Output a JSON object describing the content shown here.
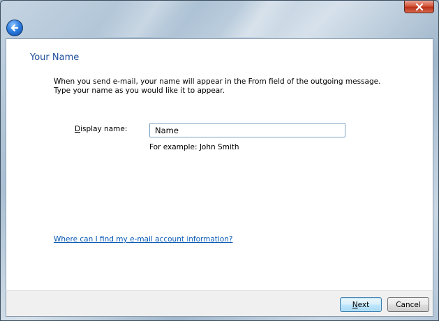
{
  "window": {
    "close_glyph": "close-icon",
    "back_glyph": "back-arrow-icon"
  },
  "page": {
    "title": "Your Name",
    "intro_line1": "When you send e-mail, your name will appear in the From field of the outgoing message.",
    "intro_line2": "Type your name as you would like it to appear."
  },
  "form": {
    "display_label_underlined": "D",
    "display_label_rest": "isplay name:",
    "display_value": "Name",
    "example": "For example: John Smith"
  },
  "help": {
    "link_text": "Where can I find my e-mail account information?"
  },
  "footer": {
    "next_underlined": "N",
    "next_rest": "ext",
    "cancel_label": "Cancel"
  },
  "colors": {
    "title_blue": "#1f4e9a",
    "link_blue": "#0b5bb5",
    "close_red": "#c8412a"
  }
}
